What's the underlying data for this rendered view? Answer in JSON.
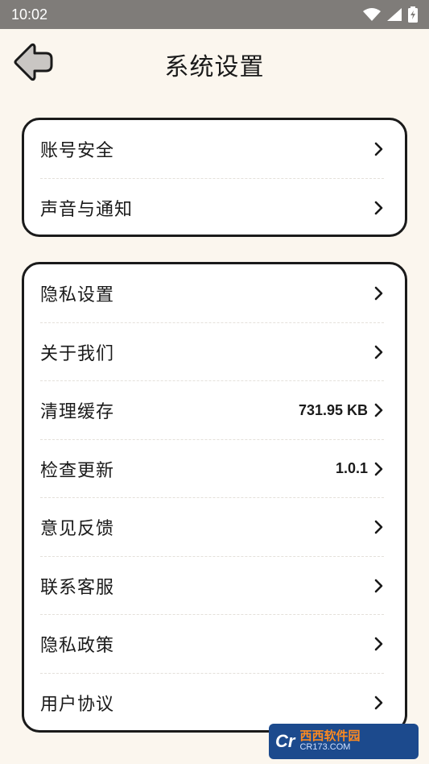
{
  "statusbar": {
    "time": "10:02",
    "icons": [
      "wifi-icon",
      "signal-icon",
      "battery-charging-icon"
    ]
  },
  "header": {
    "title": "系统设置",
    "back_icon": "back-arrow-icon"
  },
  "group1": {
    "items": [
      {
        "label": "账号安全",
        "value": ""
      },
      {
        "label": "声音与通知",
        "value": ""
      }
    ]
  },
  "group2": {
    "items": [
      {
        "label": "隐私设置",
        "value": ""
      },
      {
        "label": "关于我们",
        "value": ""
      },
      {
        "label": "清理缓存",
        "value": "731.95 KB"
      },
      {
        "label": "检查更新",
        "value": "1.0.1"
      },
      {
        "label": "意见反馈",
        "value": ""
      },
      {
        "label": "联系客服",
        "value": ""
      },
      {
        "label": "隐私政策",
        "value": ""
      },
      {
        "label": "用户协议",
        "value": ""
      }
    ]
  },
  "watermark": {
    "logo": "Cr",
    "main": "西西软件园",
    "sub": "CR173.COM"
  },
  "colors": {
    "background": "#fbf6ee",
    "statusbar": "#7f7c79",
    "card": "#ffffff",
    "border": "#1a1a1a",
    "back_button_fill": "#c9c6c3"
  }
}
